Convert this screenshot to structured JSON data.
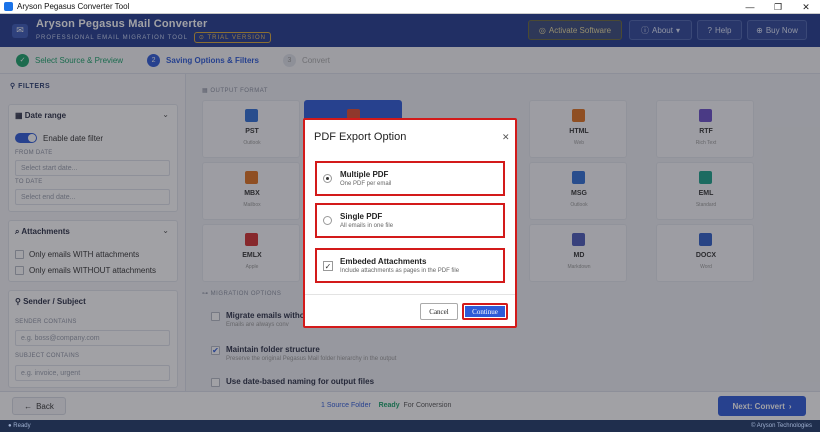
{
  "window": {
    "title": "Aryson Pegasus Converter Tool"
  },
  "header": {
    "app_name": "Aryson Pegasus Mail Converter",
    "subtitle": "PROFESSIONAL EMAIL MIGRATION TOOL",
    "trial_badge": "TRIAL VERSION",
    "activate_label": "Activate Software",
    "about_label": "About",
    "help_label": "Help",
    "buy_label": "Buy Now"
  },
  "steps": [
    {
      "number": "✓",
      "label": "Select Source & Preview",
      "state": "done"
    },
    {
      "number": "2",
      "label": "Saving Options & Filters",
      "state": "active"
    },
    {
      "number": "3",
      "label": "Convert",
      "state": "pending"
    }
  ],
  "sidebar": {
    "heading": "FILTERS",
    "date_range": {
      "title": "Date range",
      "toggle_label": "Enable date filter",
      "from_label": "FROM DATE",
      "from_placeholder": "Select start date...",
      "to_label": "TO DATE",
      "to_placeholder": "Select end date..."
    },
    "attachments": {
      "title": "Attachments",
      "with_label": "Only emails WITH attachments",
      "without_label": "Only emails WITHOUT attachments"
    },
    "sender": {
      "title": "Sender / Subject",
      "sender_label": "SENDER CONTAINS",
      "sender_placeholder": "e.g. boss@company.com",
      "subject_label": "SUBJECT CONTAINS",
      "subject_placeholder": "e.g. invoice, urgent"
    }
  },
  "main": {
    "format_heading": "OUTPUT FORMAT",
    "formats": [
      {
        "name": "PST",
        "desc": "Outlook",
        "color": "#2f6fd6"
      },
      {
        "name": "",
        "desc": "",
        "color": "#e04a2f"
      },
      {
        "name": "HTML",
        "desc": "Web",
        "color": "#e0731f"
      },
      {
        "name": "RTF",
        "desc": "Rich Text",
        "color": "#6a4fc9"
      },
      {
        "name": "MBX",
        "desc": "Mailbox",
        "color": "#e0731f"
      },
      {
        "name": "MSG",
        "desc": "Outlook",
        "color": "#2f6fd6"
      },
      {
        "name": "EML",
        "desc": "Standard",
        "color": "#1aa38a"
      },
      {
        "name": "EMLX",
        "desc": "Apple",
        "color": "#d32f2f"
      },
      {
        "name": "MD",
        "desc": "Markdown",
        "color": "#4a5bb8"
      },
      {
        "name": "DOCX",
        "desc": "Word",
        "color": "#2f5fc9"
      }
    ],
    "migration_heading": "MIGRATION OPTIONS",
    "options": [
      {
        "title": "Migrate emails witho",
        "desc": "Emails are always conv",
        "checked": false
      },
      {
        "title": "Maintain folder structure",
        "desc": "Preserve the original Pegasus Mail folder hierarchy in the output",
        "checked": true
      },
      {
        "title": "Use date-based naming for output files",
        "desc": "",
        "checked": false
      }
    ]
  },
  "footer": {
    "back_label": "Back",
    "status_count": "1 Source Folder",
    "status_ready": "Ready",
    "status_suffix": "For Conversion",
    "next_label": "Next: Convert"
  },
  "statusbar": {
    "left": "● Ready",
    "right": "© Aryson Technologies"
  },
  "modal": {
    "title": "PDF Export Option",
    "options": [
      {
        "title": "Multiple PDF",
        "desc": "One PDF per email",
        "type": "radio",
        "selected": true
      },
      {
        "title": "Single PDF",
        "desc": "All emails in one file",
        "type": "radio",
        "selected": false
      },
      {
        "title": "Embeded Attachments",
        "desc": "Include attachments as pages in the PDF file",
        "type": "checkbox",
        "selected": true
      }
    ],
    "cancel_label": "Cancel",
    "continue_label": "Continue"
  },
  "colors": {
    "header": "#233c8f",
    "accent": "#2d5ad8",
    "highlight": "#d31a1a",
    "success": "#1aa36a"
  }
}
